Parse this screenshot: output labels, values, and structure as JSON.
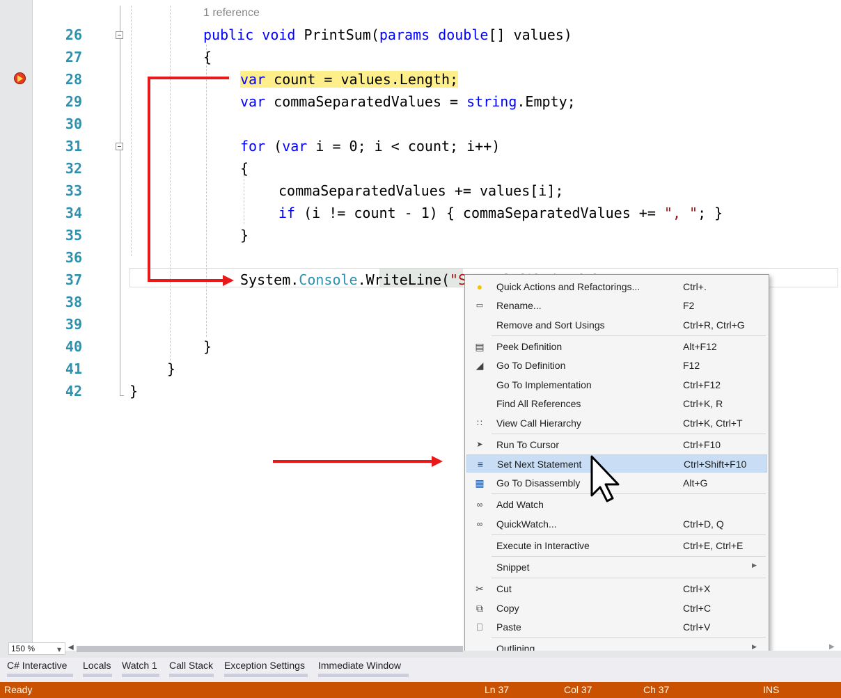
{
  "editor": {
    "codelens": "1 reference",
    "line_numbers": [
      "26",
      "27",
      "28",
      "29",
      "30",
      "31",
      "32",
      "33",
      "34",
      "35",
      "36",
      "37",
      "38",
      "39",
      "40",
      "41",
      "42"
    ],
    "current_line": "28"
  },
  "context_menu": {
    "items": [
      {
        "icon": "lightbulb-icon",
        "label": "Quick Actions and Refactorings...",
        "shortcut": "Ctrl+."
      },
      {
        "icon": "rename-icon",
        "label": "Rename...",
        "shortcut": "F2"
      },
      {
        "icon": "",
        "label": "Remove and Sort Usings",
        "shortcut": "Ctrl+R, Ctrl+G"
      },
      {
        "icon": "peek-definition-icon",
        "label": "Peek Definition",
        "shortcut": "Alt+F12"
      },
      {
        "icon": "go-to-definition-icon",
        "label": "Go To Definition",
        "shortcut": "F12"
      },
      {
        "icon": "",
        "label": "Go To Implementation",
        "shortcut": "Ctrl+F12"
      },
      {
        "icon": "",
        "label": "Find All References",
        "shortcut": "Ctrl+K, R"
      },
      {
        "icon": "call-hierarchy-icon",
        "label": "View Call Hierarchy",
        "shortcut": "Ctrl+K, Ctrl+T"
      },
      {
        "icon": "run-to-cursor-icon",
        "label": "Run To Cursor",
        "shortcut": "Ctrl+F10"
      },
      {
        "icon": "set-next-statement-icon",
        "label": "Set Next Statement",
        "shortcut": "Ctrl+Shift+F10"
      },
      {
        "icon": "disassembly-icon",
        "label": "Go To Disassembly",
        "shortcut": "Alt+G"
      },
      {
        "icon": "glasses-icon",
        "label": "Add Watch",
        "shortcut": ""
      },
      {
        "icon": "glasses-icon",
        "label": "QuickWatch...",
        "shortcut": "Ctrl+D, Q"
      },
      {
        "icon": "",
        "label": "Execute in Interactive",
        "shortcut": "Ctrl+E, Ctrl+E"
      },
      {
        "icon": "",
        "label": "Snippet",
        "shortcut": ""
      },
      {
        "icon": "scissors-icon",
        "label": "Cut",
        "shortcut": "Ctrl+X"
      },
      {
        "icon": "copy-icon",
        "label": "Copy",
        "shortcut": "Ctrl+C"
      },
      {
        "icon": "paste-icon",
        "label": "Paste",
        "shortcut": "Ctrl+V"
      },
      {
        "icon": "",
        "label": "Outlining",
        "shortcut": ""
      }
    ],
    "highlighted": "Set Next Statement"
  },
  "zoom": {
    "value": "150 %"
  },
  "tool_tabs": [
    "C# Interactive",
    "Locals",
    "Watch 1",
    "Call Stack",
    "Exception Settings",
    "Immediate Window"
  ],
  "status_bar": {
    "state": "Ready",
    "line": "Ln 37",
    "col": "Col 37",
    "ch": "Ch 37",
    "mode": "INS"
  },
  "colors": {
    "status_bar": "#ca5100",
    "current_statement": "#ffef8b",
    "arrow": "#e8191a",
    "menu_hover": "#c9def5",
    "line_numbers": "#2b91af"
  }
}
